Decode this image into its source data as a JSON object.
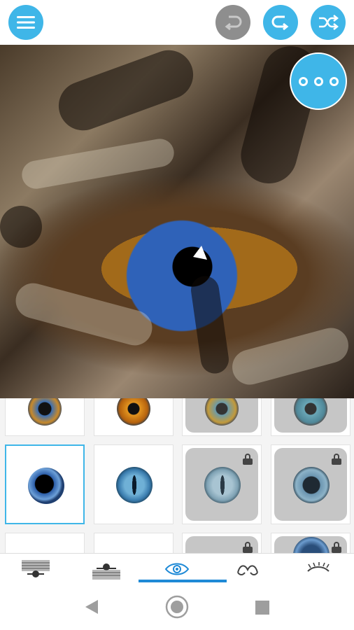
{
  "topbar": {
    "menu_icon": "hamburger-menu-icon",
    "undo_icon": "undo-icon",
    "redo_icon": "redo-icon",
    "shuffle_icon": "shuffle-icon",
    "colors": {
      "accent": "#3fb6e8",
      "disabled": "#8e8e8e"
    }
  },
  "canvas": {
    "more_icon": "more-options-icon"
  },
  "eye_grid": {
    "rows": [
      [
        {
          "style": "blue-gold",
          "locked": false
        },
        {
          "style": "orange",
          "locked": false
        },
        {
          "style": "blue-green",
          "locked": true
        },
        {
          "style": "teal",
          "locked": true
        }
      ],
      [
        {
          "style": "blue-round",
          "locked": false,
          "selected": true
        },
        {
          "style": "blue-cat",
          "locked": false
        },
        {
          "style": "pale-cat",
          "locked": true
        },
        {
          "style": "grey-round",
          "locked": true
        }
      ],
      [
        {
          "style": "blank",
          "locked": false
        },
        {
          "style": "blank",
          "locked": false
        },
        {
          "style": "blue",
          "locked": true
        },
        {
          "style": "blue",
          "locked": true
        }
      ]
    ]
  },
  "tabs": [
    {
      "icon": "eyebrow-pattern-icon"
    },
    {
      "icon": "eye-pattern-icon"
    },
    {
      "icon": "eye-icon",
      "active": true
    },
    {
      "icon": "eyelash-icon"
    },
    {
      "icon": "closed-eye-icon"
    }
  ],
  "system_nav": {
    "back_icon": "back-triangle-icon",
    "home_icon": "home-circle-icon",
    "recents_icon": "recents-square-icon"
  }
}
